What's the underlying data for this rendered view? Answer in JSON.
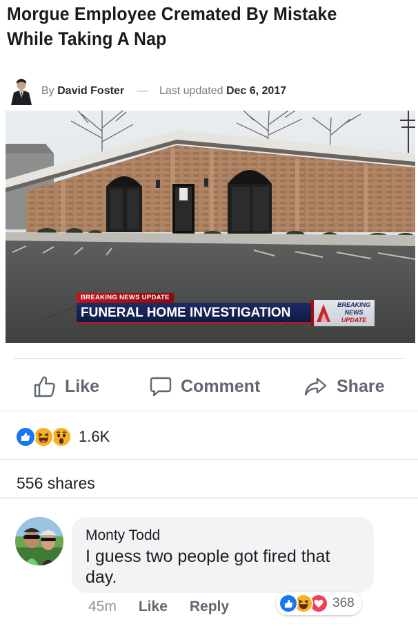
{
  "article": {
    "headline_line1": "Morgue Employee Cremated By Mistake",
    "headline_line2": "While Taking A Nap",
    "by_prefix": "By",
    "author": "David Foster",
    "separator": "—",
    "updated_prefix": "Last updated",
    "updated_date": "Dec 6, 2017"
  },
  "image": {
    "banner_top": "BREAKING NEWS UPDATE",
    "banner_main": "FUNERAL HOME INVESTIGATION",
    "badge_line1": "BREAKING",
    "badge_line2": "NEWS",
    "badge_line3": "UPDATE"
  },
  "actions": {
    "like_label": "Like",
    "comment_label": "Comment",
    "share_label": "Share"
  },
  "reactions": {
    "icons": [
      "like-icon",
      "haha-icon",
      "wow-icon"
    ],
    "count": "1.6K"
  },
  "shares": {
    "text": "556 shares"
  },
  "comment": {
    "author": "Monty Todd",
    "text": "I guess two people got fired that day.",
    "time": "45m",
    "like_label": "Like",
    "reply_label": "Reply",
    "reaction_icons": [
      "like-icon",
      "haha-icon",
      "love-icon"
    ],
    "reaction_count": "368"
  },
  "colors": {
    "fb_blue": "#1877f2",
    "love_red": "#f33e58",
    "haha_yellow": "#f7b125",
    "text_gray": "#606770",
    "news_red": "#c4121a",
    "news_navy": "#1d2d63"
  }
}
